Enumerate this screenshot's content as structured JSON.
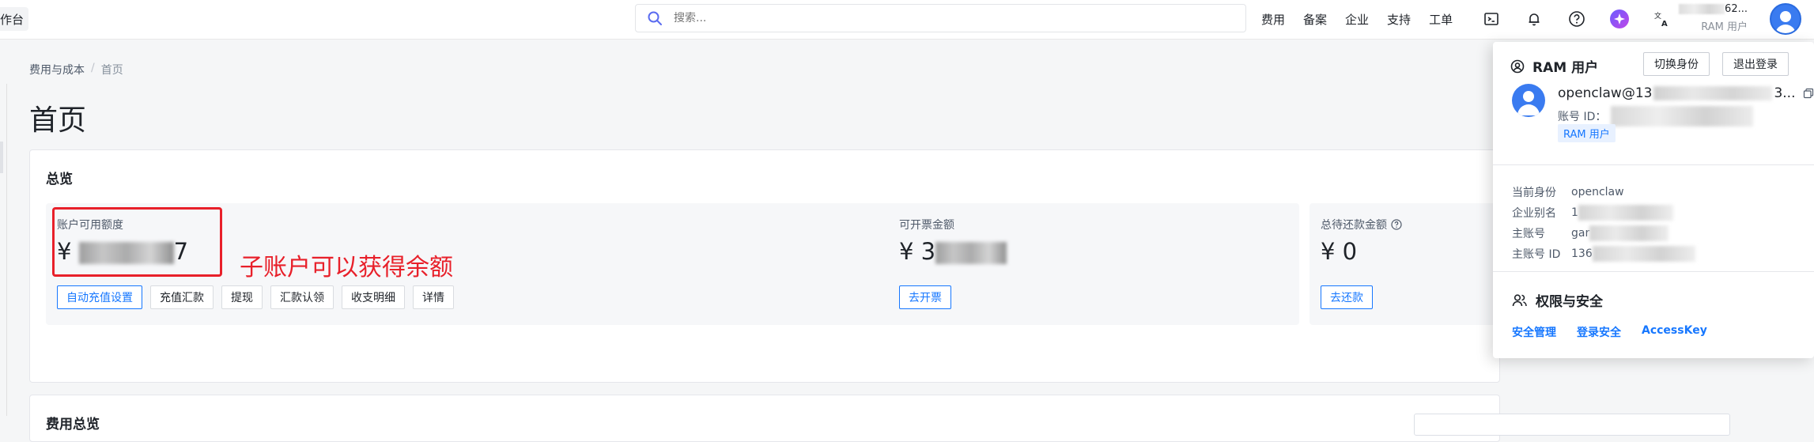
{
  "topbar": {
    "workbench_label": "作台",
    "search_placeholder": "搜索...",
    "nav_links": [
      "费用",
      "备案",
      "企业",
      "支持",
      "工单"
    ],
    "user_account_prefix": "",
    "user_account_suffix": "62...",
    "user_role": "RAM 用户"
  },
  "breadcrumb": {
    "parent": "费用与成本",
    "current": "首页"
  },
  "page_title": "首页",
  "overview": {
    "title": "总览",
    "panels": [
      {
        "label": "账户可用额度",
        "value_prefix": "¥ ",
        "value_visible": "7",
        "buttons": [
          "自动充值设置",
          "充值汇款",
          "提现",
          "汇款认领",
          "收支明细",
          "详情"
        ]
      },
      {
        "label": "可开票金额",
        "value_prefix": "¥ 3",
        "value_visible": "",
        "buttons": [
          "去开票"
        ]
      },
      {
        "label": "总待还款金额",
        "value_prefix": "¥ 0",
        "value_visible": "",
        "buttons": [
          "去还款"
        ]
      }
    ]
  },
  "annotation": "子账户可以获得余额",
  "cost_overview": {
    "title": "费用总览"
  },
  "dropdown": {
    "header": "RAM 用户",
    "switch_button": "切换身份",
    "logout_button": "退出登录",
    "email_prefix": "openclaw@13",
    "email_suffix": "3...",
    "id_label": "账号 ID：",
    "tag": "RAM 用户",
    "info": [
      {
        "key": "当前身份",
        "value": "openclaw"
      },
      {
        "key": "企业别名",
        "value": "1"
      },
      {
        "key": "主账号",
        "value": "gar"
      },
      {
        "key": "主账号 ID",
        "value": "136"
      }
    ],
    "security_title": "权限与安全",
    "security_links": [
      "安全管理",
      "登录安全",
      "AccessKey"
    ]
  },
  "colors": {
    "accent": "#1677ff",
    "annotation_red": "#e8202a"
  }
}
